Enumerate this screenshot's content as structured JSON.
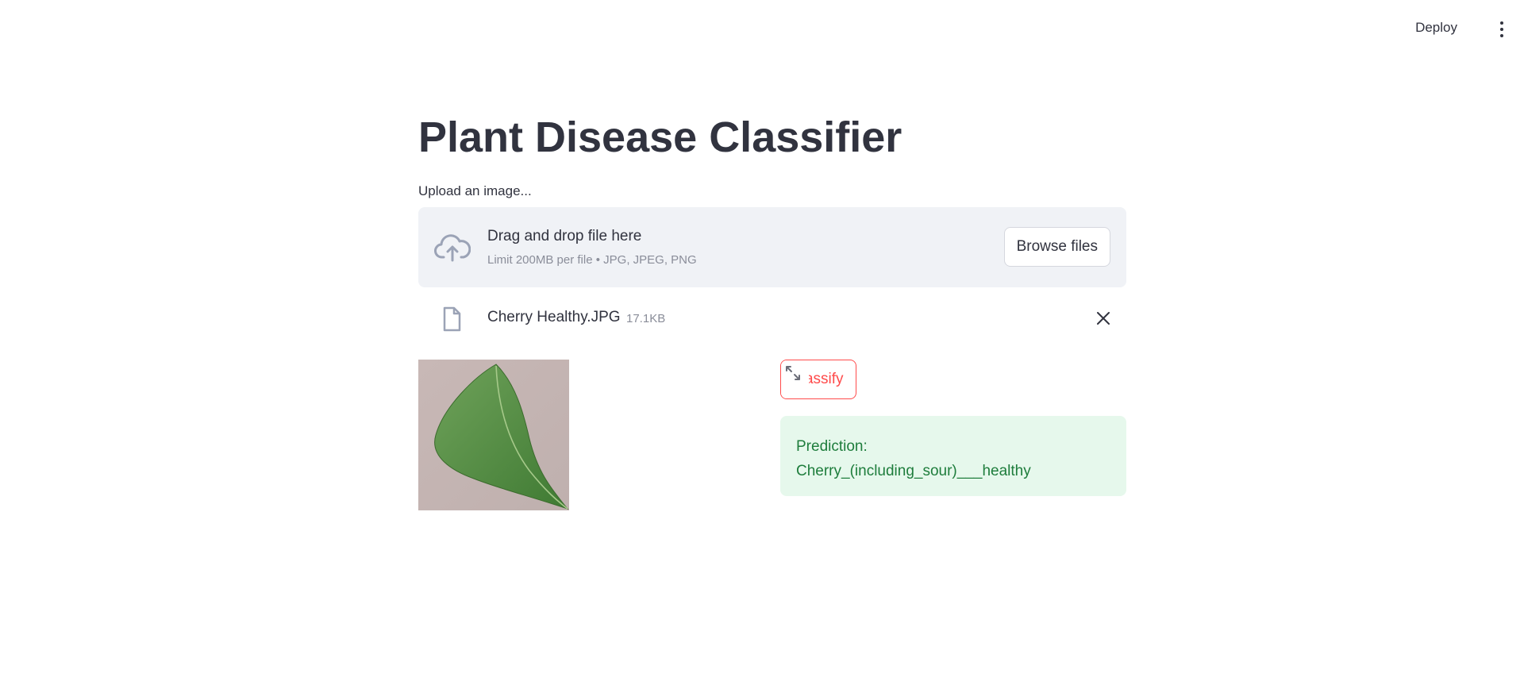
{
  "toolbar": {
    "deploy_label": "Deploy",
    "menu_icon": "more-vertical-icon"
  },
  "page": {
    "title": "Plant Disease Classifier"
  },
  "uploader": {
    "label": "Upload an image...",
    "drop_title": "Drag and drop file here",
    "drop_limits": "Limit 200MB per file • JPG, JPEG, PNG",
    "browse_label": "Browse files",
    "icon": "cloud-upload-icon"
  },
  "file": {
    "name": "Cherry Healthy.JPG",
    "size": "17.1KB",
    "icon": "file-icon",
    "remove_icon": "close-icon"
  },
  "classify": {
    "button_label": "Classify",
    "expand_icon": "fullscreen-icon"
  },
  "result": {
    "heading": "Prediction:",
    "value": "Cherry_(including_sour)___healthy"
  },
  "colors": {
    "primary": "#ff4b4b",
    "text": "#31333f",
    "dropzone_bg": "#f0f2f6",
    "success_bg": "#e6f8ec",
    "success_text": "#1e7d3c"
  }
}
